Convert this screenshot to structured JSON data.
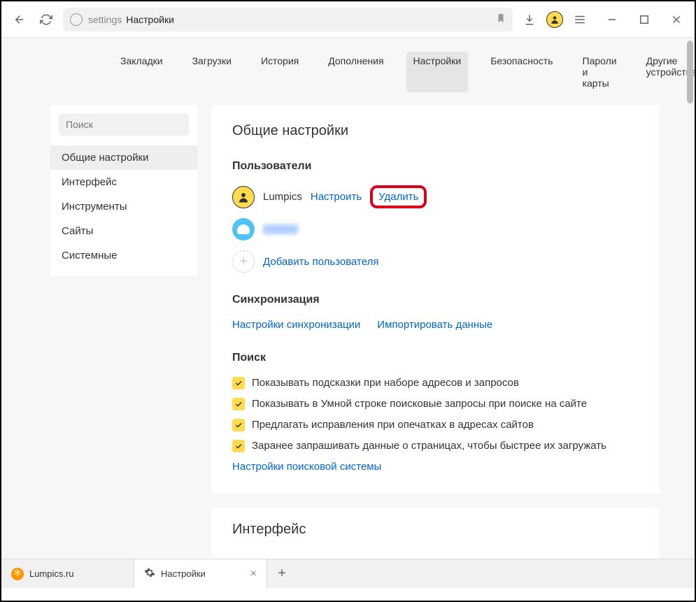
{
  "toolbar": {
    "address_prefix": "settings",
    "address_main": "Настройки"
  },
  "nav": {
    "bookmarks": "Закладки",
    "downloads": "Загрузки",
    "history": "История",
    "addons": "Дополнения",
    "settings": "Настройки",
    "security": "Безопасность",
    "passwords": "Пароли и карты",
    "devices": "Другие устройства"
  },
  "sidebar": {
    "search_placeholder": "Поиск",
    "general": "Общие настройки",
    "interface": "Интерфейс",
    "tools": "Инструменты",
    "sites": "Сайты",
    "system": "Системные"
  },
  "main": {
    "title": "Общие настройки",
    "users_heading": "Пользователи",
    "user1_name": "Lumpics",
    "configure": "Настроить",
    "delete": "Удалить",
    "add_user": "Добавить пользователя",
    "sync_heading": "Синхронизация",
    "sync_settings": "Настройки синхронизации",
    "import_data": "Импортировать данные",
    "search_heading": "Поиск",
    "check1": "Показывать подсказки при наборе адресов и запросов",
    "check2": "Показывать в Умной строке поисковые запросы при поиске на сайте",
    "check3": "Предлагать исправления при опечатках в адресах сайтов",
    "check4": "Заранее запрашивать данные о страницах, чтобы быстрее их загружать",
    "search_engine": "Настройки поисковой системы",
    "interface_heading": "Интерфейс"
  },
  "tabs": {
    "tab1": "Lumpics.ru",
    "tab2": "Настройки"
  }
}
